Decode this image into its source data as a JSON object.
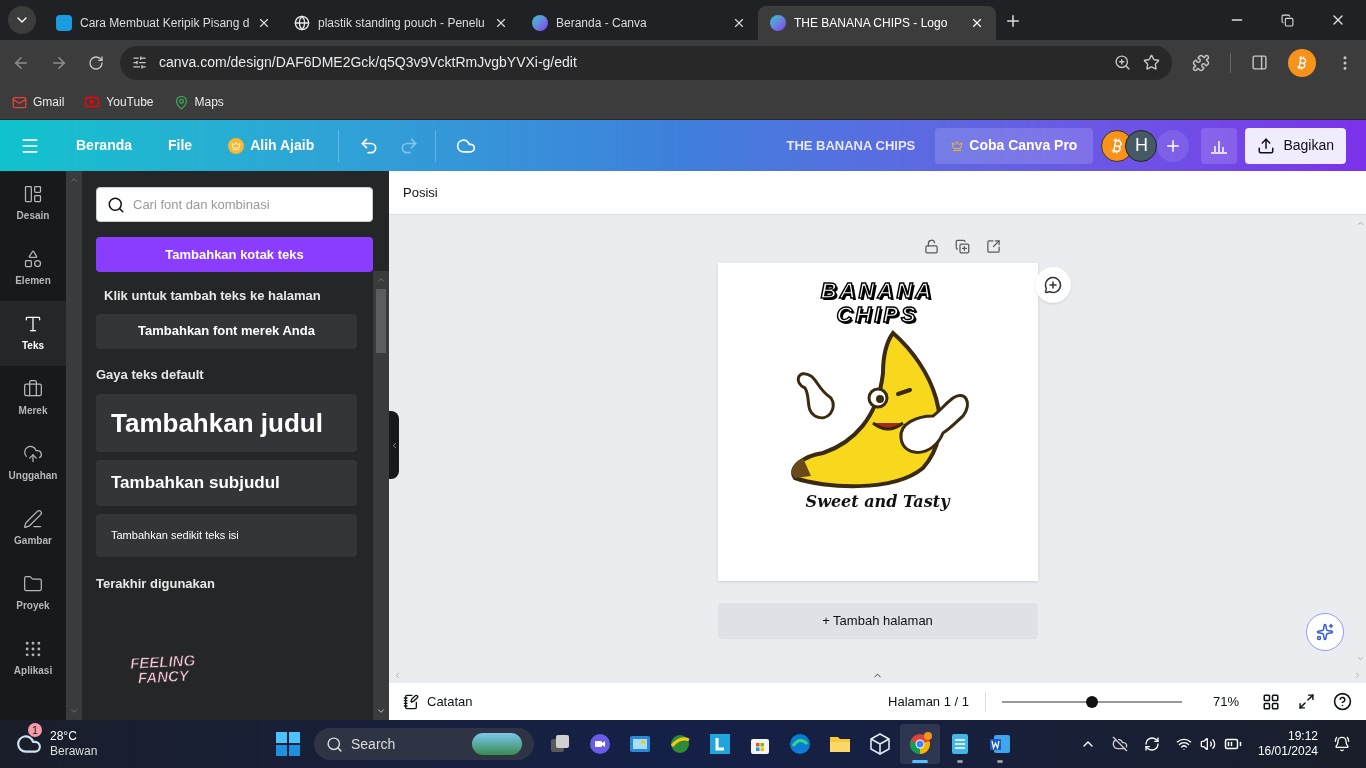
{
  "browser": {
    "tabs": [
      {
        "title": "Cara Membuat Keripik Pisang d",
        "kind": "doc",
        "selected": false
      },
      {
        "title": "plastik standing pouch - Penelu",
        "kind": "search",
        "selected": false
      },
      {
        "title": "Beranda - Canva",
        "kind": "canva",
        "selected": false
      },
      {
        "title": "THE BANANA CHIPS - Logo",
        "kind": "canva",
        "selected": true
      }
    ],
    "url": "canva.com/design/DAF6DME2Gck/q5Q3v9VcktRmJvgbYVXi-g/edit",
    "bookmarks": [
      {
        "label": "Gmail",
        "kind": "mail"
      },
      {
        "label": "YouTube",
        "kind": "video"
      },
      {
        "label": "Maps",
        "kind": "map"
      }
    ]
  },
  "editor": {
    "menu": [
      {
        "label": "Beranda",
        "kind": "plain"
      },
      {
        "label": "File",
        "kind": "plain"
      },
      {
        "label": "Alih Ajaib",
        "kind": "crown"
      }
    ],
    "redo_disabled": true,
    "doc_title": "THE BANANA CHIPS",
    "pro_button": "Coba Canva Pro",
    "avatar": "H",
    "share_button": "Bagikan"
  },
  "rail": [
    {
      "label": "Desain",
      "kind": "design",
      "selected": false
    },
    {
      "label": "Elemen",
      "kind": "elements",
      "selected": false
    },
    {
      "label": "Teks",
      "kind": "text",
      "selected": true
    },
    {
      "label": "Merek",
      "kind": "brand",
      "selected": false
    },
    {
      "label": "Unggahan",
      "kind": "upload",
      "selected": false
    },
    {
      "label": "Gambar",
      "kind": "draw",
      "selected": false
    },
    {
      "label": "Proyek",
      "kind": "folder",
      "selected": false
    },
    {
      "label": "Aplikasi",
      "kind": "apps",
      "selected": false
    }
  ],
  "panel": {
    "search": {
      "placeholder": "Cari font dan kombinasi"
    },
    "add_textbox": "Tambahkan kotak teks",
    "hint": "Klik untuk tambah teks ke halaman",
    "brand_font": "Tambahkan font merek Anda",
    "default_heading": "Gaya teks default",
    "styles": [
      {
        "kind": "heading",
        "label": "Tambahkan judul"
      },
      {
        "kind": "subheading",
        "label": "Tambahkan subjudul"
      },
      {
        "kind": "body",
        "label": "Tambahkan sedikit teks isi"
      }
    ],
    "recent_heading": "Terakhir digunakan",
    "recent": [
      "FEELING",
      "FANCY"
    ]
  },
  "toolbar": {
    "label": "Posisi"
  },
  "design": {
    "title_lines": [
      "BANANA",
      "CHIPS"
    ],
    "tagline": "Sweet and Tasty"
  },
  "add_page": "+ Tambah halaman",
  "footer": {
    "notes": "Catatan",
    "page": "Halaman 1 / 1",
    "zoom": {
      "level": 0.5,
      "reading": "71%"
    }
  },
  "taskbar": {
    "weather": {
      "badge": "1",
      "temp": "28°C",
      "desc": "Berawan"
    },
    "search": "Search",
    "apps": [
      {
        "kind": "windows",
        "running": false,
        "selected": false
      },
      {
        "kind": "video",
        "running": false,
        "selected": false
      },
      {
        "kind": "photo",
        "running": false,
        "selected": false
      },
      {
        "kind": "globe",
        "running": false,
        "selected": false
      },
      {
        "kind": "letter",
        "running": false,
        "selected": false
      },
      {
        "kind": "store",
        "running": false,
        "selected": false
      },
      {
        "kind": "wave",
        "running": false,
        "selected": false
      },
      {
        "kind": "folder",
        "running": false,
        "selected": false
      },
      {
        "kind": "cube",
        "running": false,
        "selected": false
      },
      {
        "kind": "browser",
        "running": true,
        "selected": true
      },
      {
        "kind": "notepad",
        "running": true,
        "selected": false
      },
      {
        "kind": "word",
        "running": true,
        "selected": false
      }
    ],
    "time": "19:12",
    "date": "16/01/2024"
  }
}
